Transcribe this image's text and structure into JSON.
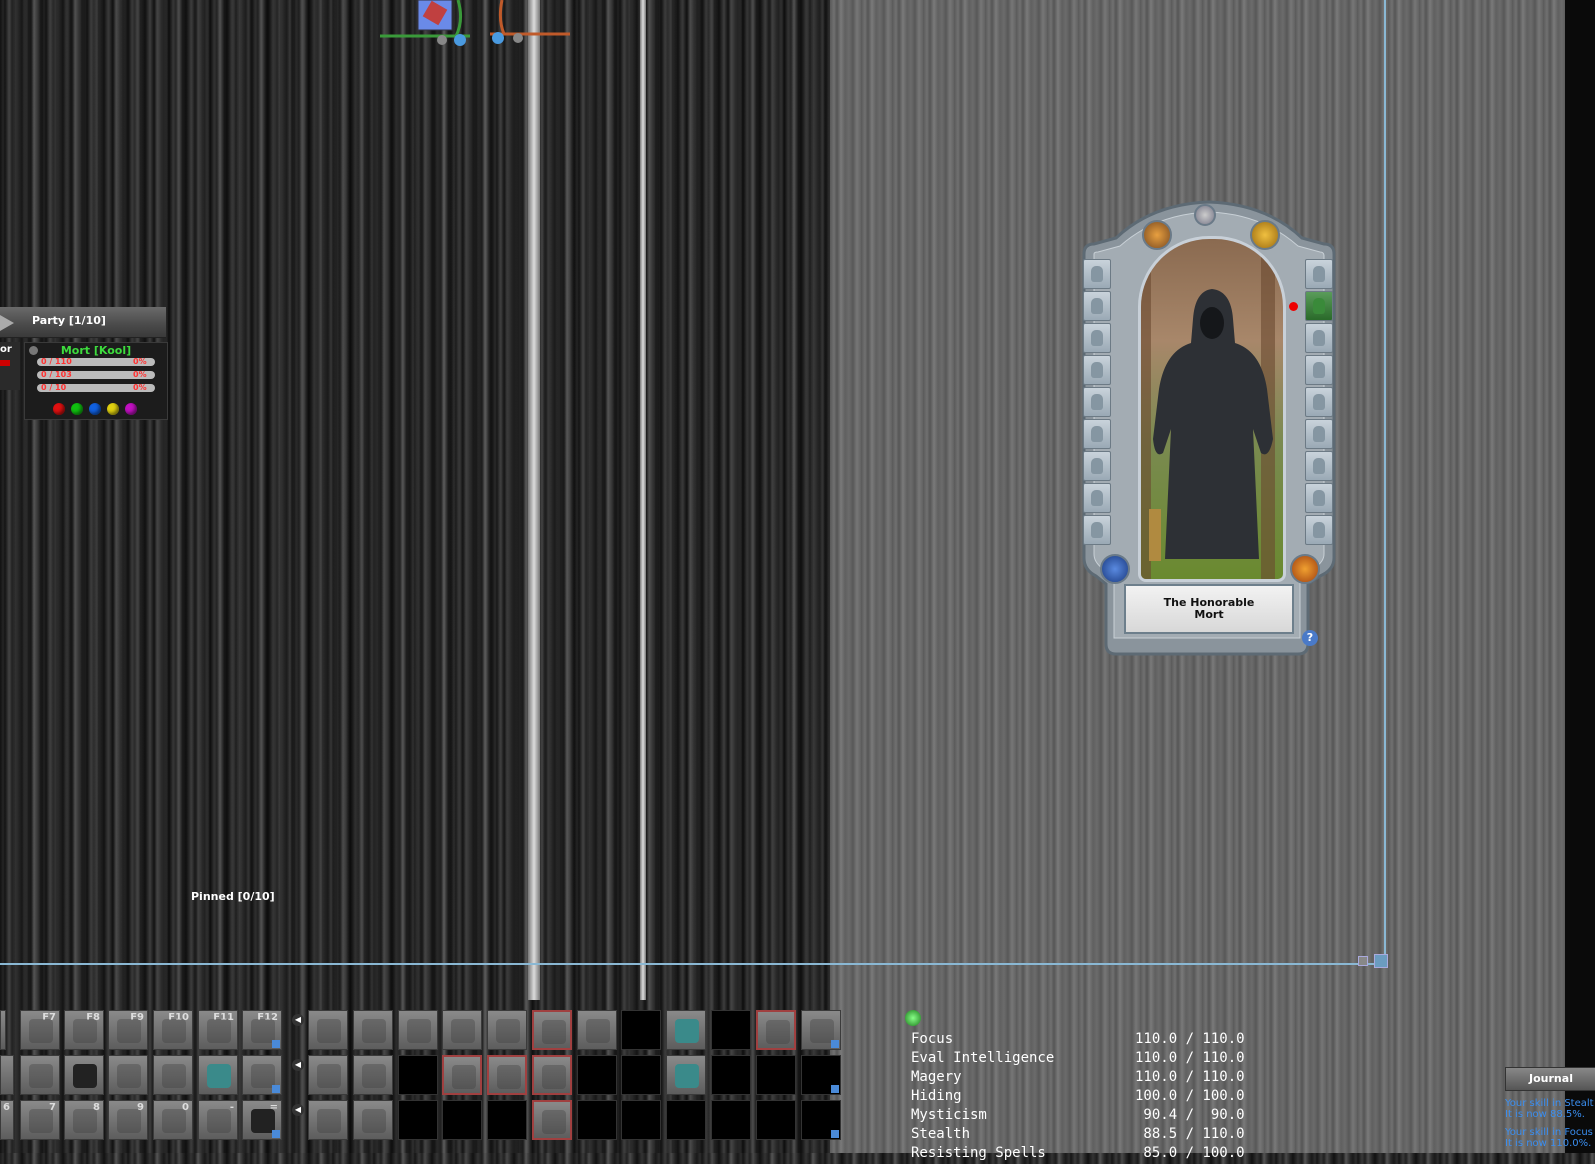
{
  "party": {
    "title": "Party [1/10]",
    "left_partial_label": "or",
    "member": {
      "name": "Mort [Kool]",
      "bars": [
        {
          "text": "0 / 110",
          "pct": "0%",
          "fill": 0
        },
        {
          "text": "0 / 103",
          "pct": "0%",
          "fill": 0
        },
        {
          "text": "0 / 10",
          "pct": "0%",
          "fill": 0
        }
      ],
      "dot_colors": [
        "#e01010",
        "#10c010",
        "#1060e0",
        "#e0d010",
        "#c010c0"
      ]
    }
  },
  "pinned": {
    "label": "Pinned [0/10]"
  },
  "paperdoll": {
    "name_line1": "The Honorable",
    "name_line2": "Mort",
    "help": "?"
  },
  "hotbar": {
    "row1_keys": [
      "F7",
      "F8",
      "F9",
      "F10",
      "F11",
      "F12"
    ],
    "row3_keys": [
      "6",
      "7",
      "8",
      "9",
      "0",
      "-",
      "="
    ]
  },
  "skills": [
    {
      "name": "Focus",
      "value": "110.0 / 110.0"
    },
    {
      "name": "Eval Intelligence",
      "value": "110.0 / 110.0"
    },
    {
      "name": "Magery",
      "value": "110.0 / 110.0"
    },
    {
      "name": "Hiding",
      "value": "100.0 / 100.0"
    },
    {
      "name": "Mysticism",
      "value": " 90.4 /  90.0"
    },
    {
      "name": "Stealth",
      "value": " 88.5 / 110.0"
    },
    {
      "name": "Resisting Spells",
      "value": " 85.0 / 100.0"
    }
  ],
  "journal": {
    "tab_label": "Journal",
    "messages": [
      {
        "line1": "Your skill in Stealt",
        "line2": "It is now 88.5%."
      },
      {
        "line1": "Your skill in Focus",
        "line2": "It is now 110.0%."
      }
    ]
  }
}
